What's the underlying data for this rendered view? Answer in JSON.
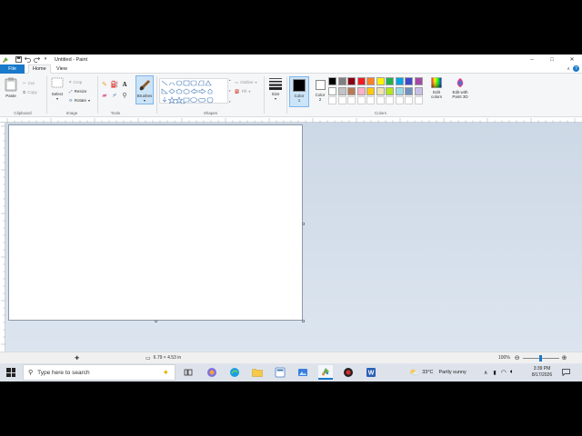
{
  "window": {
    "title": "Untitled - Paint",
    "minimize": "–",
    "maximize": "□",
    "close": "✕"
  },
  "menu": {
    "file": "File",
    "home": "Home",
    "view": "View"
  },
  "ribbon": {
    "clipboard": {
      "label": "Clipboard",
      "paste": "Paste",
      "cut": "Cut",
      "copy": "Copy"
    },
    "image": {
      "label": "Image",
      "select": "Select",
      "crop": "Crop",
      "resize": "Resize",
      "rotate": "Rotate"
    },
    "tools": {
      "label": "Tools"
    },
    "brushes": {
      "label": "Brushes"
    },
    "shapes": {
      "label": "Shapes",
      "outline": "Outline",
      "fill": "Fill"
    },
    "size": {
      "label": "Size"
    },
    "colors": {
      "label": "Colors",
      "color1": "Color 1",
      "color2": "Color 2",
      "edit_colors": "Edit colors",
      "edit_paint3d": "Edit with Paint 3D",
      "palette_row1": [
        "#000000",
        "#7f7f7f",
        "#880015",
        "#ed1c24",
        "#ff7f27",
        "#fff200",
        "#22b14c",
        "#00a2e8",
        "#3f48cc",
        "#a349a4"
      ],
      "palette_row2": [
        "#ffffff",
        "#c3c3c3",
        "#b97a57",
        "#ffaec9",
        "#ffc90e",
        "#efe4b0",
        "#b5e61d",
        "#99d9ea",
        "#7092be",
        "#c8bfe7"
      ],
      "color1_value": "#000000",
      "color2_value": "#ffffff"
    }
  },
  "status": {
    "image_size": "6.79 × 4.53 in",
    "zoom": "100%",
    "zoom_fraction": 0.5
  },
  "taskbar": {
    "search_placeholder": "Type here to search",
    "weather_temp": "33°C",
    "weather_desc": "Partly sunny",
    "time": "3:39 PM",
    "date": "8/17/2026"
  }
}
